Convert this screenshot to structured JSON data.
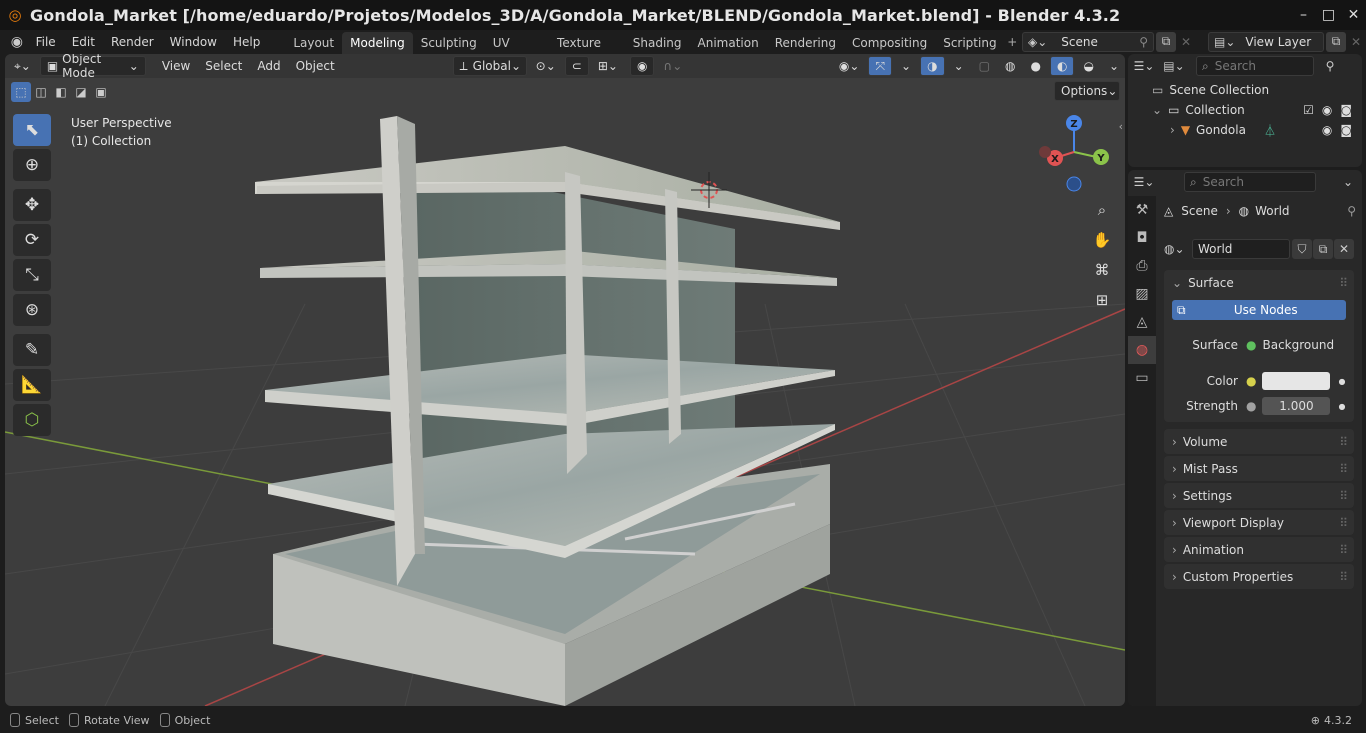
{
  "window": {
    "title": "Gondola_Market [/home/eduardo/Projetos/Modelos_3D/A/Gondola_Market/BLEND/Gondola_Market.blend] - Blender 4.3.2",
    "controls": [
      "–",
      "□",
      "✕"
    ]
  },
  "menu": [
    "File",
    "Edit",
    "Render",
    "Window",
    "Help"
  ],
  "workspaces": [
    {
      "label": "Layout",
      "active": false
    },
    {
      "label": "Modeling",
      "active": true
    },
    {
      "label": "Sculpting",
      "active": false
    },
    {
      "label": "UV Editing",
      "active": false
    },
    {
      "label": "Texture Paint",
      "active": false
    },
    {
      "label": "Shading",
      "active": false
    },
    {
      "label": "Animation",
      "active": false
    },
    {
      "label": "Rendering",
      "active": false
    },
    {
      "label": "Compositing",
      "active": false
    },
    {
      "label": "Scripting",
      "active": false
    }
  ],
  "scene_selector": "Scene",
  "view_layer": "View Layer",
  "viewport_header": {
    "mode": "Object Mode",
    "menus": [
      "View",
      "Select",
      "Add",
      "Object"
    ],
    "orientation": "Global",
    "options_label": "Options"
  },
  "viewport_overlay": {
    "perspective": "User Perspective",
    "collection": "(1) Collection"
  },
  "gizmo": {
    "x": "X",
    "y": "Y",
    "z": "Z"
  },
  "outliner": {
    "search_placeholder": "Search",
    "scene_collection": "Scene Collection",
    "collection": "Collection",
    "object": "Gondola"
  },
  "properties": {
    "search_placeholder": "Search",
    "breadcrumb_scene": "Scene",
    "breadcrumb_world": "World",
    "world_name": "World",
    "surface_panel": "Surface",
    "use_nodes": "Use Nodes",
    "surface_label": "Surface",
    "surface_value": "Background",
    "color_label": "Color",
    "strength_label": "Strength",
    "strength_value": "1.000",
    "collapsed_panels": [
      "Volume",
      "Mist Pass",
      "Settings",
      "Viewport Display",
      "Animation",
      "Custom Properties"
    ]
  },
  "statusbar": {
    "select": "Select",
    "rotate": "Rotate View",
    "object": "Object",
    "version": "4.3.2"
  },
  "colors": {
    "accent": "#4772b3",
    "viewport_bg": "#3d3d3d",
    "axis_x": "#e05353",
    "axis_y": "#8bc34a",
    "axis_z": "#4a86e8"
  }
}
